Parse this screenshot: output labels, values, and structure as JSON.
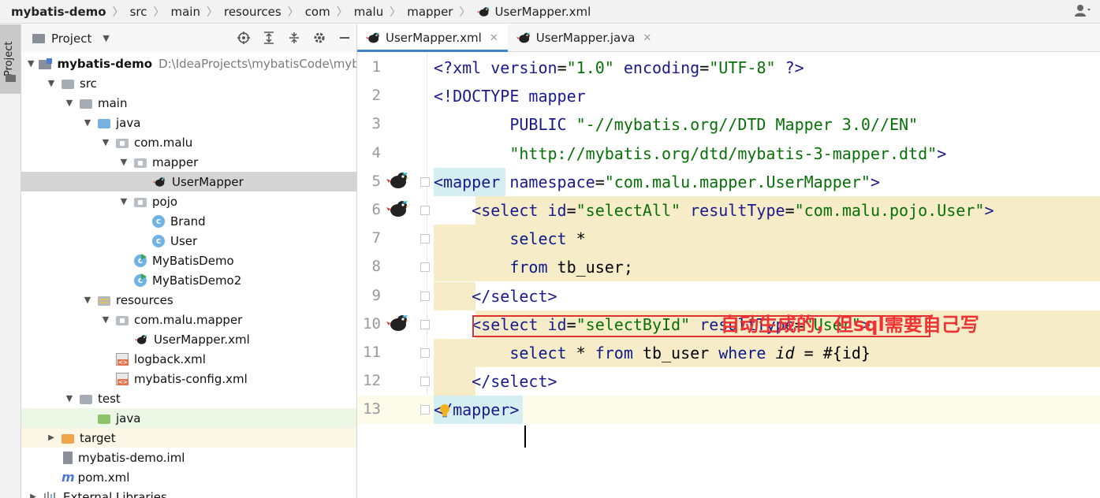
{
  "breadcrumb": [
    "mybatis-demo",
    "src",
    "main",
    "resources",
    "com",
    "malu",
    "mapper",
    "UserMapper.xml"
  ],
  "sidebar_tab": "Project",
  "project_panel": {
    "title": "Project",
    "tree": [
      {
        "label": "mybatis-demo",
        "path": "D:\\IdeaProjects\\mybatisCode\\myb",
        "icon": "module-icon",
        "arrow": "down",
        "indent": 0
      },
      {
        "label": "src",
        "icon": "folder-icon",
        "arrow": "down",
        "indent": 1
      },
      {
        "label": "main",
        "icon": "folder-icon",
        "arrow": "down",
        "indent": 2
      },
      {
        "label": "java",
        "icon": "source-folder-icon",
        "arrow": "down",
        "indent": 3
      },
      {
        "label": "com.malu",
        "icon": "package-icon",
        "arrow": "down",
        "indent": 4
      },
      {
        "label": "mapper",
        "icon": "package-icon",
        "arrow": "down",
        "indent": 5
      },
      {
        "label": "UserMapper",
        "icon": "mybatis-bird-icon",
        "arrow": "none",
        "indent": 6,
        "selected": true
      },
      {
        "label": "pojo",
        "icon": "package-icon",
        "arrow": "down",
        "indent": 5
      },
      {
        "label": "Brand",
        "icon": "class-icon",
        "arrow": "none",
        "indent": 6
      },
      {
        "label": "User",
        "icon": "class-icon",
        "arrow": "none",
        "indent": 6
      },
      {
        "label": "MyBatisDemo",
        "icon": "runnable-class-icon",
        "arrow": "none",
        "indent": 5
      },
      {
        "label": "MyBatisDemo2",
        "icon": "runnable-class-icon",
        "arrow": "none",
        "indent": 5
      },
      {
        "label": "resources",
        "icon": "resources-folder-icon",
        "arrow": "down",
        "indent": 3
      },
      {
        "label": "com.malu.mapper",
        "icon": "package-icon",
        "arrow": "down",
        "indent": 4
      },
      {
        "label": "UserMapper.xml",
        "icon": "mybatis-bird-icon",
        "arrow": "none",
        "indent": 5
      },
      {
        "label": "logback.xml",
        "icon": "xml-file-icon",
        "arrow": "none",
        "indent": 4
      },
      {
        "label": "mybatis-config.xml",
        "icon": "xml-file-icon",
        "arrow": "none",
        "indent": 4
      },
      {
        "label": "test",
        "icon": "folder-icon",
        "arrow": "down",
        "indent": 2
      },
      {
        "label": "java",
        "icon": "test-folder-icon",
        "arrow": "none",
        "indent": 3,
        "highlight": "test"
      },
      {
        "label": "target",
        "icon": "excluded-folder-icon",
        "arrow": "right",
        "indent": 1,
        "highlight": "target"
      },
      {
        "label": "mybatis-demo.iml",
        "icon": "iml-file-icon",
        "arrow": "none",
        "indent": 1
      },
      {
        "label": "pom.xml",
        "icon": "maven-icon",
        "arrow": "none",
        "indent": 1
      },
      {
        "label": "External Libraries",
        "icon": "libraries-icon",
        "arrow": "right",
        "indent": 0
      }
    ]
  },
  "tabs": [
    {
      "label": "UserMapper.xml",
      "active": true
    },
    {
      "label": "UserMapper.java",
      "active": false
    }
  ],
  "editor": {
    "line_numbers": [
      "1",
      "2",
      "3",
      "4",
      "5",
      "6",
      "7",
      "8",
      "9",
      "10",
      "11",
      "12",
      "13"
    ],
    "annotation": "自动生成的，但sql需要自己写",
    "lines": [
      [
        {
          "t": "<?",
          "c": "dt"
        },
        {
          "t": "xml ",
          "c": "dt"
        },
        {
          "t": "version",
          "c": "attr"
        },
        {
          "t": "=",
          "c": "plain"
        },
        {
          "t": "\"1.0\"",
          "c": "str"
        },
        {
          "t": " ",
          "c": "plain"
        },
        {
          "t": "encoding",
          "c": "attr"
        },
        {
          "t": "=",
          "c": "plain"
        },
        {
          "t": "\"UTF-8\"",
          "c": "str"
        },
        {
          "t": " ?>",
          "c": "dt"
        }
      ],
      [
        {
          "t": "<!DOCTYPE ",
          "c": "dt"
        },
        {
          "t": "mapper",
          "c": "attr"
        }
      ],
      [
        {
          "t": "        PUBLIC ",
          "c": "attr"
        },
        {
          "t": "\"-//mybatis.org//DTD Mapper 3.0//EN\"",
          "c": "str"
        }
      ],
      [
        {
          "t": "        ",
          "c": "plain"
        },
        {
          "t": "\"http://mybatis.org/dtd/mybatis-3-mapper.dtd\"",
          "c": "str"
        },
        {
          "t": ">",
          "c": "dt"
        }
      ],
      [
        {
          "t": "<mapper",
          "c": "kw-tag"
        },
        {
          "t": " ",
          "c": "plain"
        },
        {
          "t": "namespace",
          "c": "attr"
        },
        {
          "t": "=",
          "c": "plain"
        },
        {
          "t": "\"com.malu.mapper.UserMapper\"",
          "c": "str"
        },
        {
          "t": ">",
          "c": "kw-tag"
        }
      ],
      [
        {
          "t": "    <select ",
          "c": "kw-tag"
        },
        {
          "t": "id",
          "c": "attr"
        },
        {
          "t": "=",
          "c": "plain"
        },
        {
          "t": "\"selectAll\"",
          "c": "str"
        },
        {
          "t": " ",
          "c": "plain"
        },
        {
          "t": "resultType",
          "c": "attr"
        },
        {
          "t": "=",
          "c": "plain"
        },
        {
          "t": "\"com.malu.pojo.User\"",
          "c": "str"
        },
        {
          "t": ">",
          "c": "kw-tag"
        }
      ],
      [
        {
          "t": "        select ",
          "c": "sqlkw"
        },
        {
          "t": "*",
          "c": "plain italic"
        }
      ],
      [
        {
          "t": "        from ",
          "c": "sqlkw"
        },
        {
          "t": "tb_user;",
          "c": "plain"
        }
      ],
      [
        {
          "t": "    </select>",
          "c": "kw-tag"
        }
      ],
      [
        {
          "t": "    <select ",
          "c": "kw-tag"
        },
        {
          "t": "id",
          "c": "attr"
        },
        {
          "t": "=",
          "c": "plain"
        },
        {
          "t": "\"selectById\"",
          "c": "str"
        },
        {
          "t": " ",
          "c": "plain"
        },
        {
          "t": "resultType",
          "c": "attr"
        },
        {
          "t": "=",
          "c": "plain"
        },
        {
          "t": "\"User\"",
          "c": "str"
        },
        {
          "t": ">",
          "c": "kw-tag"
        }
      ],
      [
        {
          "t": "        select ",
          "c": "sqlkw"
        },
        {
          "t": "* ",
          "c": "plain italic"
        },
        {
          "t": "from ",
          "c": "sqlkw"
        },
        {
          "t": "tb_user ",
          "c": "plain"
        },
        {
          "t": "where ",
          "c": "sqlkw"
        },
        {
          "t": "id",
          "c": "plain italic"
        },
        {
          "t": " = #{id}",
          "c": "plain"
        }
      ],
      [
        {
          "t": "    </select>",
          "c": "kw-tag"
        }
      ],
      [
        {
          "t": "</mapper>",
          "c": "kw-tag"
        }
      ]
    ]
  },
  "colors": {
    "annotation": "#f03232",
    "selected_row": "#d5d5d5",
    "code_highlight": "#f6ecc7",
    "tab_underline": "#4083c9"
  }
}
